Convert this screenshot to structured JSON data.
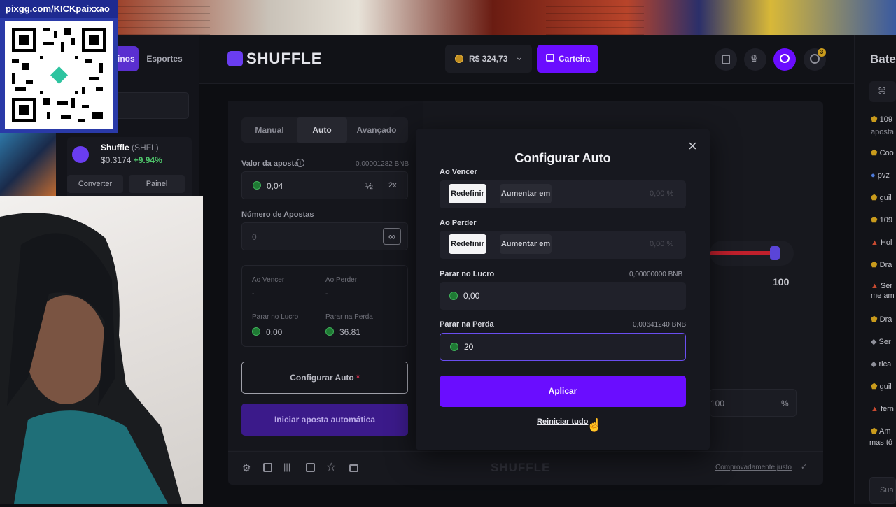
{
  "stream": {
    "pix_url": "pixgg.com/KICKpaixxao"
  },
  "topnav": {
    "tab_casinos_partial": "inos",
    "tab_sports": "Esportes",
    "logo": "SHUFFLE",
    "balance": "R$ 324,73",
    "wallet_label": "Carteira",
    "notif_count": "3"
  },
  "sidebar": {
    "token_name": "Shuffle",
    "token_symbol": "(SHFL)",
    "token_price": "$0.3174",
    "token_change": "+9.94%",
    "convert_label": "Converter",
    "panel_label": "Painel"
  },
  "left_panel": {
    "tabs": [
      "Manual",
      "Auto",
      "Avançado"
    ],
    "bet_amount_label": "Valor da aposta",
    "bet_amount_crypto": "0,00001282 BNB",
    "bet_amount_value": "0,04",
    "half_label": "½",
    "double_label": "2x",
    "num_bets_label": "Número de Apostas",
    "num_bets_value": "0",
    "infinity_symbol": "∞",
    "summary": {
      "on_win_label": "Ao Vencer",
      "on_win_value": "-",
      "on_loss_label": "Ao Perder",
      "on_loss_value": "-",
      "stop_profit_label": "Parar no Lucro",
      "stop_profit_value": "0.00",
      "stop_loss_label": "Parar na Perda",
      "stop_loss_value": "36.81"
    },
    "configure_auto_label": "Configurar Auto",
    "start_auto_label": "Iniciar aposta automática"
  },
  "game_area": {
    "slider_max": "100",
    "multiplier_partial": "100",
    "percent_symbol": "%",
    "footer_logo": "SHUFFLE",
    "provably_fair": "Comprovadamente justo"
  },
  "modal": {
    "title": "Configurar Auto",
    "on_win_label": "Ao Vencer",
    "on_win_reset": "Redefinir",
    "on_win_increase": "Aumentar em",
    "on_win_percent": "0,00 %",
    "on_loss_label": "Ao Perder",
    "on_loss_reset": "Redefinir",
    "on_loss_increase": "Aumentar em",
    "on_loss_percent": "0,00 %",
    "stop_profit_label": "Parar no Lucro",
    "stop_profit_crypto": "0,00000000 BNB",
    "stop_profit_value": "0,00",
    "stop_loss_label": "Parar na Perda",
    "stop_loss_crypto": "0,00641240 BNB",
    "stop_loss_value": "20",
    "apply_label": "Aplicar",
    "reset_all_label": "Reiniciar tudo",
    "close_symbol": "×"
  },
  "chat": {
    "title_partial": "Bate",
    "messages": [
      "109",
      "aposta",
      "Coo",
      "pvz",
      "guil",
      "109",
      "Hol",
      "Dra",
      "Ser",
      "me am",
      "Dra",
      "Ser",
      "rica",
      "guil",
      "fern",
      "Am",
      "mas tô"
    ],
    "send_partial": "Sua"
  },
  "colors": {
    "accent": "#6a0dff",
    "accent_dark": "#3b1a8a",
    "positive": "#4ec36a",
    "slider_red": "#c0202c"
  }
}
